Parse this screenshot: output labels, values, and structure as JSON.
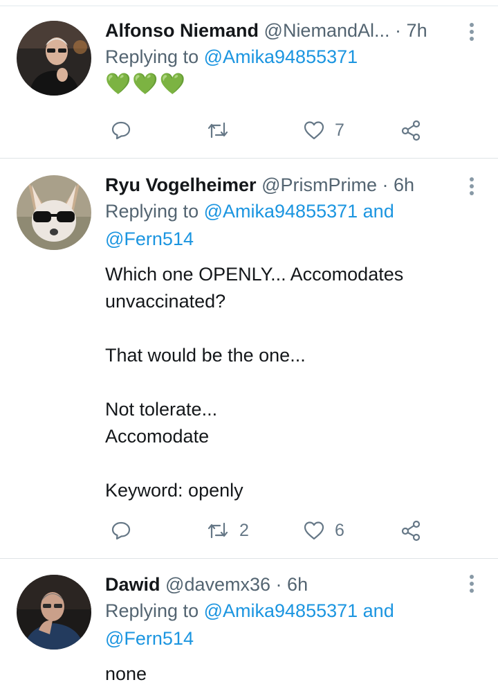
{
  "tweets": [
    {
      "name": "Alfonso Niemand",
      "handle": "@NiemandAl...",
      "sep": "·",
      "time": "7h",
      "replying_prefix": "Replying to ",
      "mention1": "@Amika94855371",
      "body": "💚💚💚",
      "retweets": "",
      "likes": "7"
    },
    {
      "name": "Ryu Vogelheimer",
      "handle": "@PrismPrime",
      "sep": "·",
      "time": "6h",
      "replying_prefix": "Replying to ",
      "mention1": "@Amika94855371",
      "and": " and",
      "mention2": "@Fern514",
      "body": "Which one OPENLY... Accomodates\nunvaccinated?\n\nThat would be the one...\n\nNot tolerate...\nAccomodate\n\nKeyword: openly",
      "retweets": "2",
      "likes": "6"
    },
    {
      "name": "Dawid",
      "handle": "@davemx36",
      "sep": "·",
      "time": "6h",
      "replying_prefix": "Replying to ",
      "mention1": "@Amika94855371",
      "and": " and",
      "mention2": "@Fern514",
      "body": "none"
    }
  ],
  "icons": [
    "reply-icon",
    "retweet-icon",
    "like-icon",
    "share-icon",
    "more-icon"
  ],
  "colors": {
    "link": "#1b95e0",
    "secondary": "#536471",
    "heart_emoji": "#6ab04c",
    "icon": "#657786"
  }
}
